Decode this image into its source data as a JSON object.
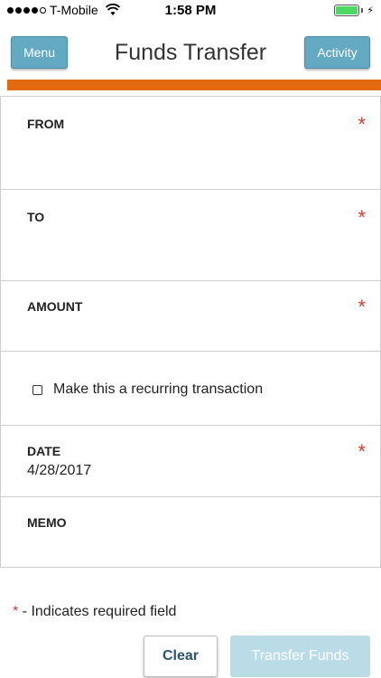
{
  "status_bar": {
    "carrier": "T-Mobile",
    "time": "1:58 PM",
    "battery_icon": "battery-icon",
    "wifi_icon": "wifi-icon"
  },
  "nav": {
    "menu_label": "Menu",
    "title": "Funds Transfer",
    "activity_label": "Activity"
  },
  "colors": {
    "accent_orange": "#e3690f",
    "button_blue": "#64a9c2",
    "required_red": "#d9392a"
  },
  "form": {
    "from": {
      "label": "FROM",
      "required": "*"
    },
    "to": {
      "label": "TO",
      "required": "*"
    },
    "amount": {
      "label": "AMOUNT",
      "required": "*"
    },
    "recurring": {
      "label": "Make this a recurring transaction"
    },
    "date": {
      "label": "DATE",
      "required": "*",
      "value": "4/28/2017"
    },
    "memo": {
      "label": "MEMO"
    }
  },
  "footer": {
    "required_star": "*",
    "required_note": " - Indicates required field",
    "clear_label": "Clear",
    "transfer_label": "Transfer Funds"
  }
}
